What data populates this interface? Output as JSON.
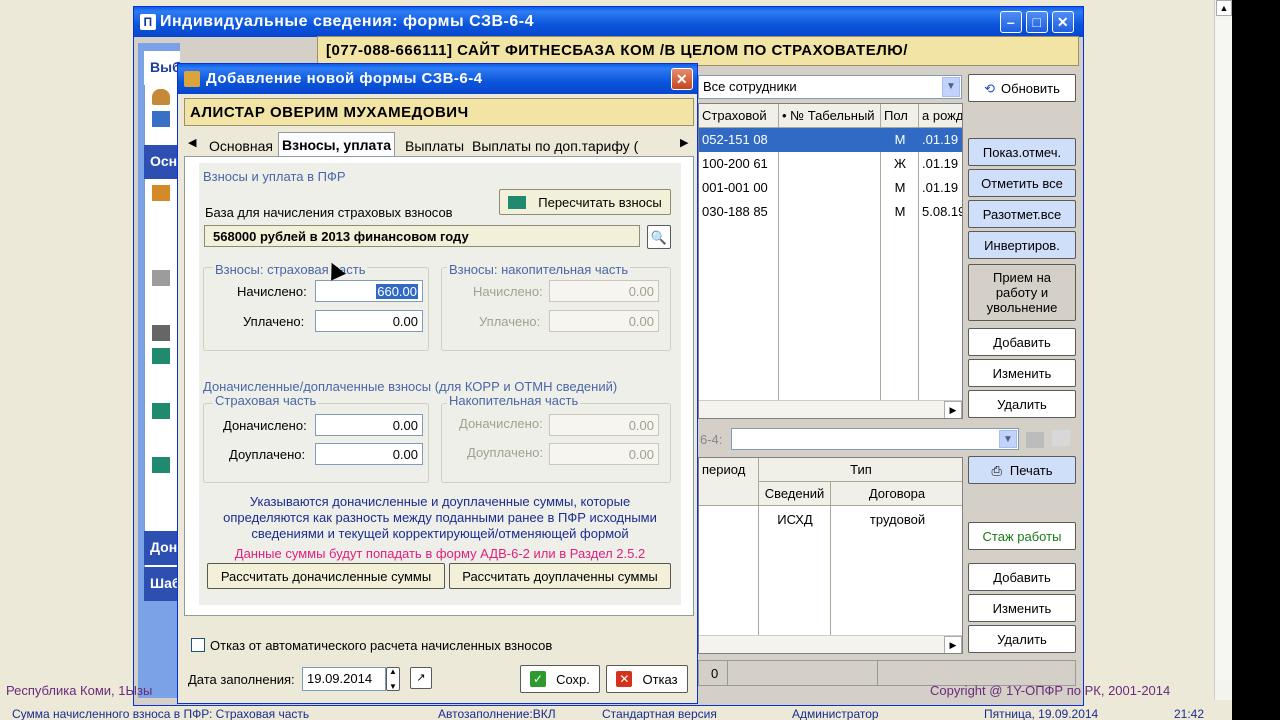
{
  "main_window": {
    "title": "Индивидуальные сведения: формы СЗВ-6-4",
    "company_bar": "[077-088-666111] САЙТ ФИТНЕСБАЗА КОМ /В ЦЕЛОМ ПО СТРАХОВАТЕЛЮ/",
    "left_tabs": [
      "Выб",
      "Осн",
      "Дон",
      "Шаб"
    ],
    "employee_filter": "Все сотрудники",
    "refresh_button": "Обновить",
    "employees_table": {
      "columns": [
        "Страховой",
        "• № Табельный",
        "Пол",
        "а рожд"
      ],
      "rows": [
        {
          "snils": "052-151 08",
          "tab": "",
          "sex": "М",
          "dob": ".01.19"
        },
        {
          "snils": "100-200 61",
          "tab": "",
          "sex": "Ж",
          "dob": ".01.19"
        },
        {
          "snils": "001-001 00",
          "tab": "",
          "sex": "М",
          "dob": ".01.19"
        },
        {
          "snils": "030-188 85",
          "tab": "",
          "sex": "М",
          "dob": "5.08.19"
        }
      ]
    },
    "side_buttons": {
      "show_marked": "Показ.отмеч.",
      "mark_all": "Отметить все",
      "unmark_all": "Разотмет.все",
      "invert": "Инвертиров.",
      "hire_fire": "Прием на работу и увольнение",
      "add": "Добавить",
      "edit": "Изменить",
      "delete": "Удалить",
      "print": "Печать",
      "work_experience": "Стаж работы",
      "add2": "Добавить",
      "edit2": "Изменить",
      "delete2": "Удалить"
    },
    "form_combo_label": "6-4:",
    "forms_table": {
      "group_header": "Тип",
      "columns": [
        "период",
        "Сведений",
        "Договора"
      ],
      "rows": [
        {
          "period": "",
          "type": "ИСХД",
          "contract": "трудовой"
        }
      ]
    },
    "bottom_counter": "0",
    "footer_left": "Республика Коми, 1Ызы",
    "footer_right": "Copyright @ 1Y-ОПФР по РК, 2001-2014"
  },
  "dialog": {
    "title": "Добавление новой формы СЗВ-6-4",
    "person": "АЛИСТАР ОВЕРИМ МУХАМЕДОВИЧ",
    "tabs": [
      "Основная",
      "Взносы, уплата",
      "Выплаты",
      "Выплаты по доп.тарифу ("
    ],
    "section_pfr": "Взносы и уплата в ПФР",
    "recalc_button": "Пересчитать взносы",
    "base_label": "База для начисления страховых взносов",
    "base_value": "568000 рублей в 2013 финансовом году",
    "insurance_group": "Взносы: страховая часть",
    "savings_group": "Взносы: накопительная часть",
    "accrued_label": "Начислено:",
    "paid_label": "Уплачено:",
    "accrued_value": "660.00",
    "paid_value": "0.00",
    "savings_accrued": "0.00",
    "savings_paid": "0.00",
    "additional_section": "Доначисленные/доплаченные взносы (для КОРР и ОТМН сведений)",
    "add_insurance_group": "Страховая часть",
    "add_savings_group": "Накопительная часть",
    "add_accrued_label": "Доначислено:",
    "add_paid_label": "Доуплачено:",
    "add_accrued_value": "0.00",
    "add_paid_value": "0.00",
    "add_savings_accrued": "0.00",
    "add_savings_paid": "0.00",
    "info_line1": "Указываются доначисленные и доуплаченные суммы, которые",
    "info_line2": "определяются как разность между поданными ранее в ПФР исходными",
    "info_line3": "сведениями и текущей корректирующей/отменяющей формой",
    "warn_line": "Данные суммы будут попадать в форму АДВ-6-2 или в Раздел 2.5.2",
    "calc_accrued_button": "Рассчитать доначисленные суммы",
    "calc_paid_button": "Рассчитать доуплаченны суммы",
    "auto_calc_checkbox": "Отказ от автоматического расчета начисленных взносов",
    "date_label": "Дата заполнения:",
    "date_value": "19.09.2014",
    "save_button": "Сохр.",
    "cancel_button": "Отказ"
  },
  "statusbar": {
    "s1": "Сумма начисленного взноса в ПФР: Страховая часть",
    "s2": "Автозаполнение:ВКЛ",
    "s3": "Стандартная версия",
    "s4": "Администратор",
    "s5": "Пятница, 19.09.2014",
    "s6": "21:42"
  },
  "colors": {
    "xp_blue": "#0b55db",
    "selection": "#316ac5",
    "yellow_bar": "#f1e4a4",
    "warn": "#e0207f"
  }
}
